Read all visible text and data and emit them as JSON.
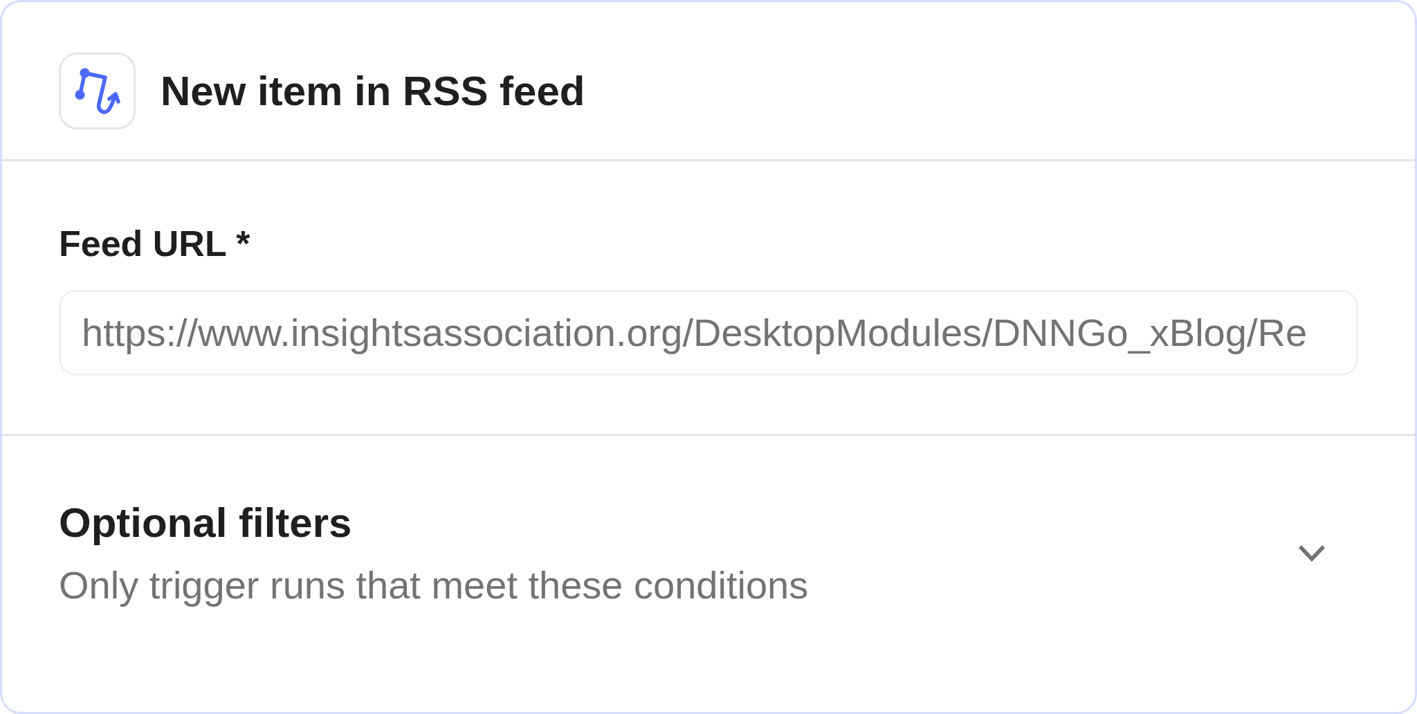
{
  "trigger": {
    "title": "New item in RSS feed"
  },
  "feed_url": {
    "label": "Feed URL *",
    "value": "https://www.insightsassociation.org/DesktopModules/DNNGo_xBlog/Re"
  },
  "optional_filters": {
    "title": "Optional filters",
    "description": "Only trigger runs that meet these conditions",
    "expanded": false
  }
}
